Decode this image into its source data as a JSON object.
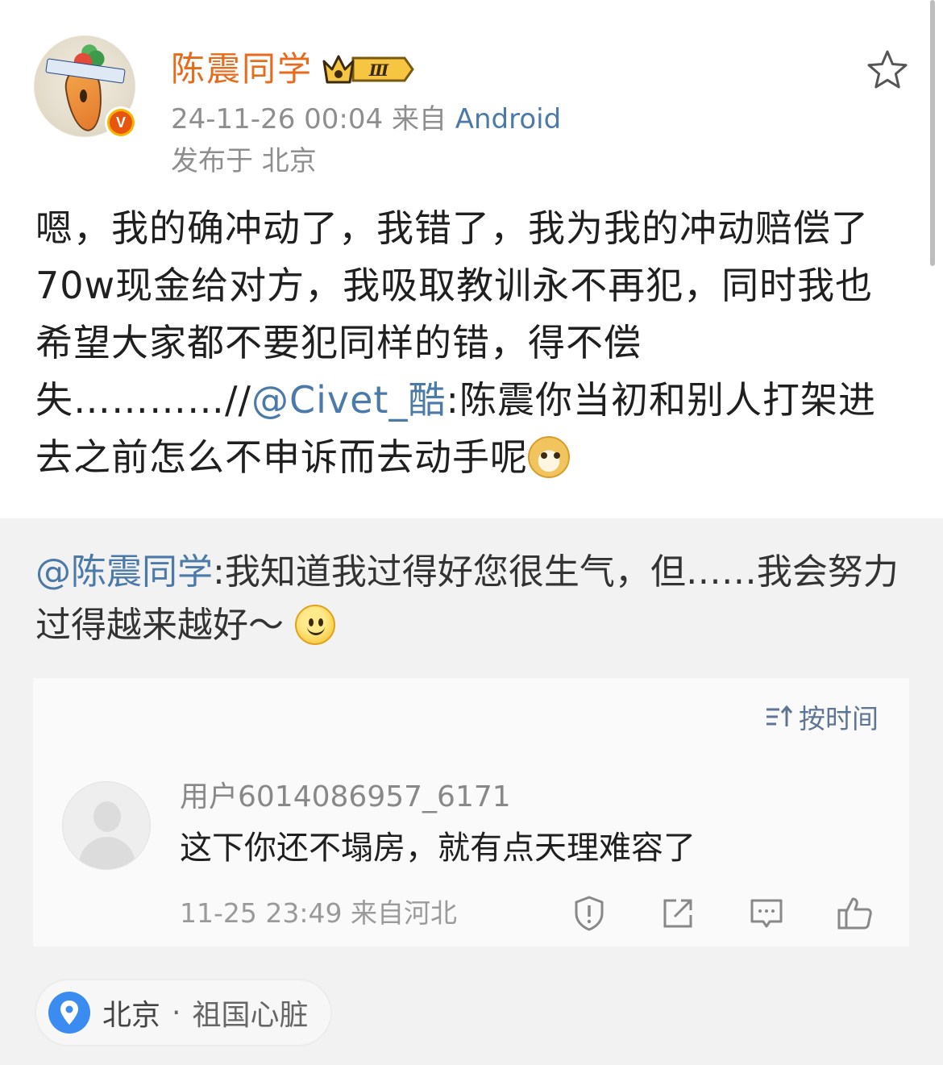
{
  "post": {
    "username": "陈震同学",
    "level_badge": "Ⅲ",
    "timestamp": "24-11-26 00:04",
    "from_label": "来自",
    "source": "Android",
    "published_at": "发布于 北京",
    "body": {
      "text_main": "嗯，我的确冲动了，我错了，我为我的冲动赔偿了70w现金给对方，我吸取教训永不再犯，同时我也希望大家都不要犯同样的错，得不偿失…………//",
      "mention": "@Civet_酷",
      "text_tail": ":陈震你当初和别人打架进去之前怎么不申诉而去动手呢"
    }
  },
  "repost": {
    "mention": "@陈震同学",
    "text": ":我知道我过得好您很生气，但……我会努力过得越来越好～"
  },
  "comments": {
    "sort_label": "按时间",
    "items": [
      {
        "user": "用户6014086957_6171",
        "text": "这下你还不塌房，就有点天理难容了",
        "meta": "11-25 23:49 来自河北"
      }
    ]
  },
  "location": {
    "city": "北京",
    "separator": "·",
    "name": "祖国心脏"
  },
  "colors": {
    "username": "#e86b1c",
    "link": "#4b7aa8",
    "badge_bg": "#f7b500",
    "v_badge": "#e8550f",
    "pin": "#3b8cf0"
  }
}
